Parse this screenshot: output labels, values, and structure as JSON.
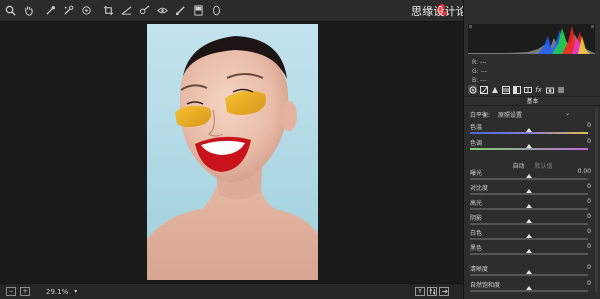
{
  "toolbar": {
    "tools": [
      "zoom-icon",
      "hand-icon",
      "white-balance-icon",
      "color-sampler-icon",
      "target-adjust-icon",
      "crop-icon",
      "straighten-icon",
      "spot-removal-icon",
      "red-eye-icon",
      "adjustment-brush-icon",
      "graduated-filter-icon",
      "radial-filter-icon"
    ]
  },
  "watermark": {
    "text": "思缘设计论坛 www.missyuan.com"
  },
  "status": {
    "zoom": "29.1%"
  },
  "view_buttons": [
    "Y",
    "",
    ""
  ],
  "histogram": {
    "r_label": "R: ---",
    "g_label": "G: ---",
    "b_label": "B: ---"
  },
  "panel": {
    "section_title": "基本",
    "white_balance_label": "白平衡:",
    "white_balance_value": "原照设置",
    "auto_label": "自动",
    "default_label": "默认值",
    "sliders": [
      {
        "label": "色温",
        "value": "0",
        "thumb": 0.5
      },
      {
        "label": "色调",
        "value": "0",
        "thumb": 0.5
      },
      {
        "label": "曝光",
        "value": "0.00",
        "thumb": 0.5
      },
      {
        "label": "对比度",
        "value": "0",
        "thumb": 0.5
      },
      {
        "label": "高光",
        "value": "0",
        "thumb": 0.5
      },
      {
        "label": "阴影",
        "value": "0",
        "thumb": 0.5
      },
      {
        "label": "白色",
        "value": "0",
        "thumb": 0.5
      },
      {
        "label": "黑色",
        "value": "0",
        "thumb": 0.5
      },
      {
        "label": "清晰度",
        "value": "0",
        "thumb": 0.5
      },
      {
        "label": "自然饱和度",
        "value": "0",
        "thumb": 0.5
      }
    ]
  },
  "colors": {
    "temp_track": "#8a7bd6",
    "tint_track": "#7fd06d",
    "accent": "#e4e4e4"
  }
}
